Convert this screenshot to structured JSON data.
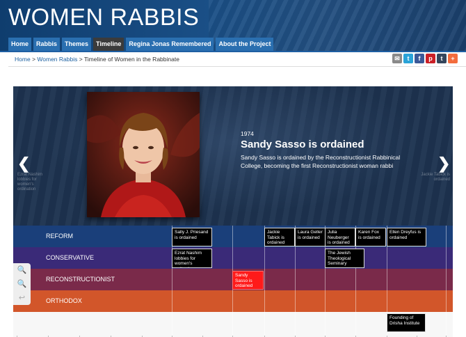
{
  "site": {
    "title": "WOMEN RABBIS"
  },
  "nav": {
    "tabs": [
      {
        "label": "Home"
      },
      {
        "label": "Rabbis"
      },
      {
        "label": "Themes"
      },
      {
        "label": "Timeline"
      },
      {
        "label": "Regina Jonas Remembered"
      },
      {
        "label": "About the Project"
      }
    ],
    "active": "Timeline"
  },
  "breadcrumb": {
    "home": "Home",
    "section": "Women Rabbis",
    "current": "Timeline of Women in the Rabbinate",
    "separator": ">"
  },
  "share": {
    "icons": [
      "email-icon",
      "twitter-icon",
      "facebook-icon",
      "pinterest-icon",
      "tumblr-icon",
      "addthis-icon"
    ],
    "glyphs": [
      "✉",
      "t",
      "f",
      "p",
      "t",
      "+"
    ],
    "colors": [
      "#8a8a8a",
      "#2aa3d8",
      "#3b5998",
      "#cb2027",
      "#35465c",
      "#f36c3d"
    ]
  },
  "slide": {
    "year": "1974",
    "headline": "Sandy Sasso is ordained",
    "body": "Sandy Sasso is ordained by the Reconstructionist Rabbinical College, becoming the first Reconstructionist woman rabbi",
    "prev_ghost": "Ezrat Nashim lobbies for women's ordination",
    "next_ghost": "Jackie Tabick is ordained"
  },
  "bands": [
    {
      "label": "REFORM",
      "color": "#1a3f7a"
    },
    {
      "label": "CONSERVATIVE",
      "color": "#3a2a78"
    },
    {
      "label": "RECONSTRUCTIONIST",
      "color": "#7a2a4a"
    },
    {
      "label": "ORTHODOX",
      "color": "#d2562a"
    }
  ],
  "markers": [
    {
      "text": "Sally J. Priesand is ordained",
      "band": "REFORM"
    },
    {
      "text": "Jackie Tabick is ordained",
      "band": "REFORM"
    },
    {
      "text": "Laura Geller is ordained",
      "band": "REFORM"
    },
    {
      "text": "Julia Neuberger is ordained",
      "band": "REFORM"
    },
    {
      "text": "Karen Fox is ordained",
      "band": "REFORM"
    },
    {
      "text": "Ellen Dreyfus is ordained",
      "band": "REFORM"
    },
    {
      "text": "Ezrat Nashim lobbies for women's ordination",
      "band": "CONSERVATIVE"
    },
    {
      "text": "The Jewish Theological Seminary",
      "band": "CONSERVATIVE"
    },
    {
      "text": "Sandy Sasso is ordained",
      "band": "RECONSTRUCTIONIST",
      "selected": true
    },
    {
      "text": "Founding of Drisha Institute",
      "band": "ORTHODOX"
    }
  ],
  "zoom": {
    "icons": [
      "zoom-in-icon",
      "zoom-out-icon",
      "back-icon"
    ],
    "glyphs": [
      "🔍",
      "🔍",
      "↩"
    ]
  }
}
